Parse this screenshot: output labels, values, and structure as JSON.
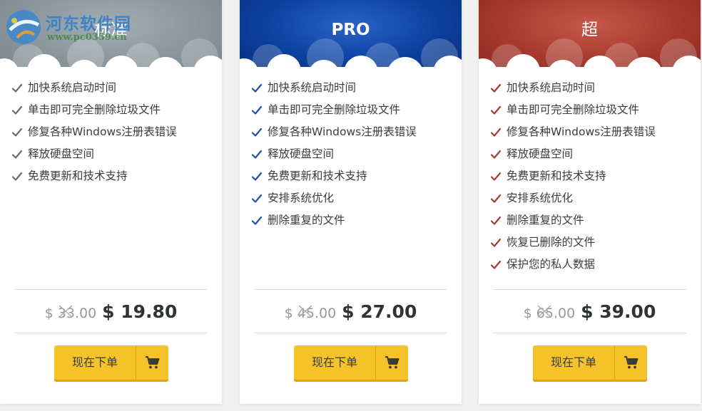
{
  "watermark": {
    "title": "河东软件园",
    "url": "www.pc0359.cn"
  },
  "plans": [
    {
      "name": "标准",
      "features": [
        "加快系统启动时间",
        "单击即可完全删除垃圾文件",
        "修复各种Windows注册表错误",
        "释放硬盘空间",
        "免费更新和技术支持"
      ],
      "old_price": "$ 33.00",
      "new_price": "$ 19.80",
      "button": "现在下单"
    },
    {
      "name": "PRO",
      "features": [
        "加快系统启动时间",
        "单击即可完全删除垃圾文件",
        "修复各种Windows注册表错误",
        "释放硬盘空间",
        "免费更新和技术支持",
        "安排系统优化",
        "删除重复的文件"
      ],
      "old_price": "$ 45.00",
      "new_price": "$ 27.00",
      "button": "现在下单"
    },
    {
      "name": "超",
      "features": [
        "加快系统启动时间",
        "单击即可完全删除垃圾文件",
        "修复各种Windows注册表错误",
        "释放硬盘空间",
        "免费更新和技术支持",
        "安排系统优化",
        "删除重复的文件",
        "恢复已删除的文件",
        "保护您的私人数据"
      ],
      "old_price": "$ 65.00",
      "new_price": "$ 39.00",
      "button": "现在下单"
    }
  ],
  "colors": {
    "standard_header": "#8b979d",
    "pro_header": "#0c41a0",
    "ultra_header": "#a8392e",
    "button": "#f5c22a"
  },
  "icons": {
    "feature": "check-icon",
    "button": "cart-icon",
    "price": "strike-icon"
  }
}
